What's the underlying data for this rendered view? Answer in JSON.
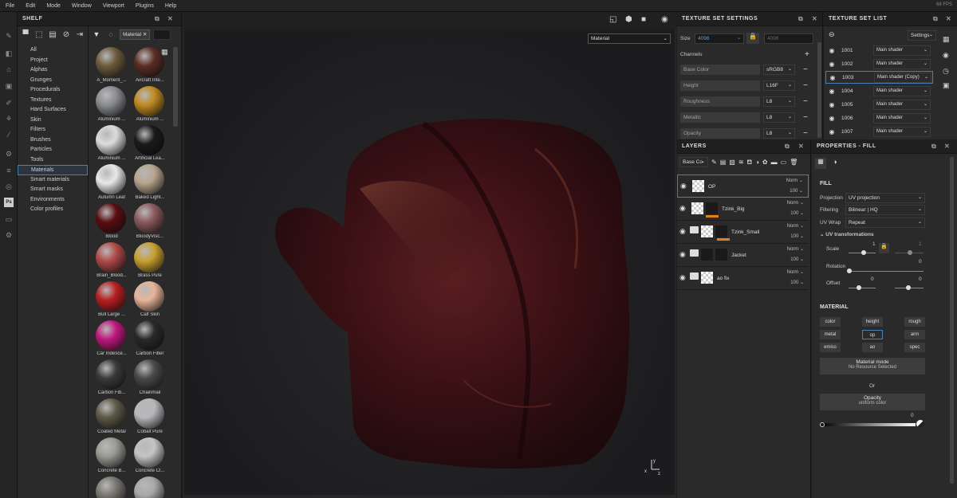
{
  "menu": [
    "File",
    "Edit",
    "Mode",
    "Window",
    "Viewport",
    "Plugins",
    "Help"
  ],
  "fps": "68 FPS",
  "shelf": {
    "title": "SHELF",
    "categories": [
      "All",
      "Project",
      "Alphas",
      "Grunges",
      "Procedurals",
      "Textures",
      "Hard Surfaces",
      "Skin",
      "Filters",
      "Brushes",
      "Particles",
      "Tools",
      "Materials",
      "Smart materials",
      "Smart masks",
      "Environments",
      "Color profiles"
    ],
    "active_category": "Materials",
    "filter_tag": "Material",
    "materials": [
      {
        "name": "A_Moment_...",
        "color": "#6d5a3c"
      },
      {
        "name": "Aircraft Inte...",
        "color": "#5a2e24"
      },
      {
        "name": "Aluminium ...",
        "color": "#8a8c90"
      },
      {
        "name": "Aluminium ...",
        "color": "#c08a20"
      },
      {
        "name": "Aluminium ...",
        "color": "#dcdcdc"
      },
      {
        "name": "Artificial Lea...",
        "color": "#1a1a1a"
      },
      {
        "name": "Autumn Leaf",
        "color": "#e8e8e8"
      },
      {
        "name": "Baked Light...",
        "color": "#b8a48e"
      },
      {
        "name": "Blood",
        "color": "#5a0e10"
      },
      {
        "name": "BloodyVisc...",
        "color": "#8a5a5e"
      },
      {
        "name": "Brain_Blood...",
        "color": "#b04a48"
      },
      {
        "name": "Brass Pure",
        "color": "#c8a030"
      },
      {
        "name": "Bull Large ...",
        "color": "#b81e22"
      },
      {
        "name": "Calf Skin",
        "color": "#e8b49a"
      },
      {
        "name": "Car Iridesce...",
        "color": "#c0187e"
      },
      {
        "name": "Carbon Fiber",
        "color": "#2a2a2a"
      },
      {
        "name": "Carbon Fib...",
        "color": "#3a3a3a"
      },
      {
        "name": "Chainmail",
        "color": "#4a4a4a"
      },
      {
        "name": "Coated Metal",
        "color": "#5e5a48"
      },
      {
        "name": "Cobalt Pure",
        "color": "#b8b8bc"
      },
      {
        "name": "Concrete B...",
        "color": "#9a9a94"
      },
      {
        "name": "Concrete Cl...",
        "color": "#c4c4c4"
      },
      {
        "name": "",
        "color": "#7a7670"
      },
      {
        "name": "",
        "color": "#a8a8a8"
      }
    ]
  },
  "viewport": {
    "mode": "Material",
    "axis_y": "y",
    "axis_x": "x",
    "axis_z": "z"
  },
  "texture_set_settings": {
    "title": "TEXTURE SET SETTINGS",
    "size_label": "Size",
    "size_value": "4096",
    "size_linked": "4096",
    "channels_label": "Channels",
    "channels": [
      {
        "name": "Base Color",
        "format": "sRGB8"
      },
      {
        "name": "Height",
        "format": "L16F"
      },
      {
        "name": "Roughness",
        "format": "L8"
      },
      {
        "name": "Metallic",
        "format": "L8"
      },
      {
        "name": "Opacity",
        "format": "L8"
      }
    ]
  },
  "texture_set_list": {
    "title": "TEXTURE SET LIST",
    "settings_label": "Settings",
    "sets": [
      {
        "id": "1001",
        "shader": "Main shader"
      },
      {
        "id": "1002",
        "shader": "Main shader"
      },
      {
        "id": "1003",
        "shader": "Main shader (Copy)"
      },
      {
        "id": "1004",
        "shader": "Main shader"
      },
      {
        "id": "1005",
        "shader": "Main shader"
      },
      {
        "id": "1006",
        "shader": "Main shader"
      },
      {
        "id": "1007",
        "shader": "Main shader"
      }
    ],
    "selected": "1003"
  },
  "layers": {
    "title": "LAYERS",
    "channel_select": "Base Co",
    "items": [
      {
        "name": "OP",
        "blend": "Norm",
        "opacity": "100"
      },
      {
        "name": "Tzink_Big",
        "blend": "Norm",
        "opacity": "100"
      },
      {
        "name": "Tzink_Small",
        "blend": "Norm",
        "opacity": "100"
      },
      {
        "name": "Jacket",
        "blend": "Norm",
        "opacity": "100"
      },
      {
        "name": "ao fix",
        "blend": "Norm",
        "opacity": "100"
      }
    ]
  },
  "properties": {
    "title": "PROPERTIES - FILL",
    "fill_label": "FILL",
    "projection_label": "Projection",
    "projection_value": "UV projection",
    "filtering_label": "Filtering",
    "filtering_value": "Bilinear | HQ",
    "uvwrap_label": "UV Wrap",
    "uvwrap_value": "Repeat",
    "uvtrans_label": "UV transformations",
    "scale_label": "Scale",
    "scale_value1": "1",
    "scale_value2": "1",
    "rotation_label": "Rotation",
    "rotation_value": "0",
    "offset_label": "Offset",
    "offset_value1": "0",
    "offset_value2": "0",
    "material_label": "MATERIAL",
    "channels": [
      "color",
      "height",
      "rough",
      "metal",
      "op",
      "arm",
      "emiss",
      "ao",
      "spec"
    ],
    "selected_channel": "op",
    "material_mode_label": "Material mode",
    "material_mode_value": "No Resource Selected",
    "or_label": "Or",
    "opacity_label": "Opacity",
    "opacity_mode": "uniform color",
    "opacity_value": "0"
  }
}
